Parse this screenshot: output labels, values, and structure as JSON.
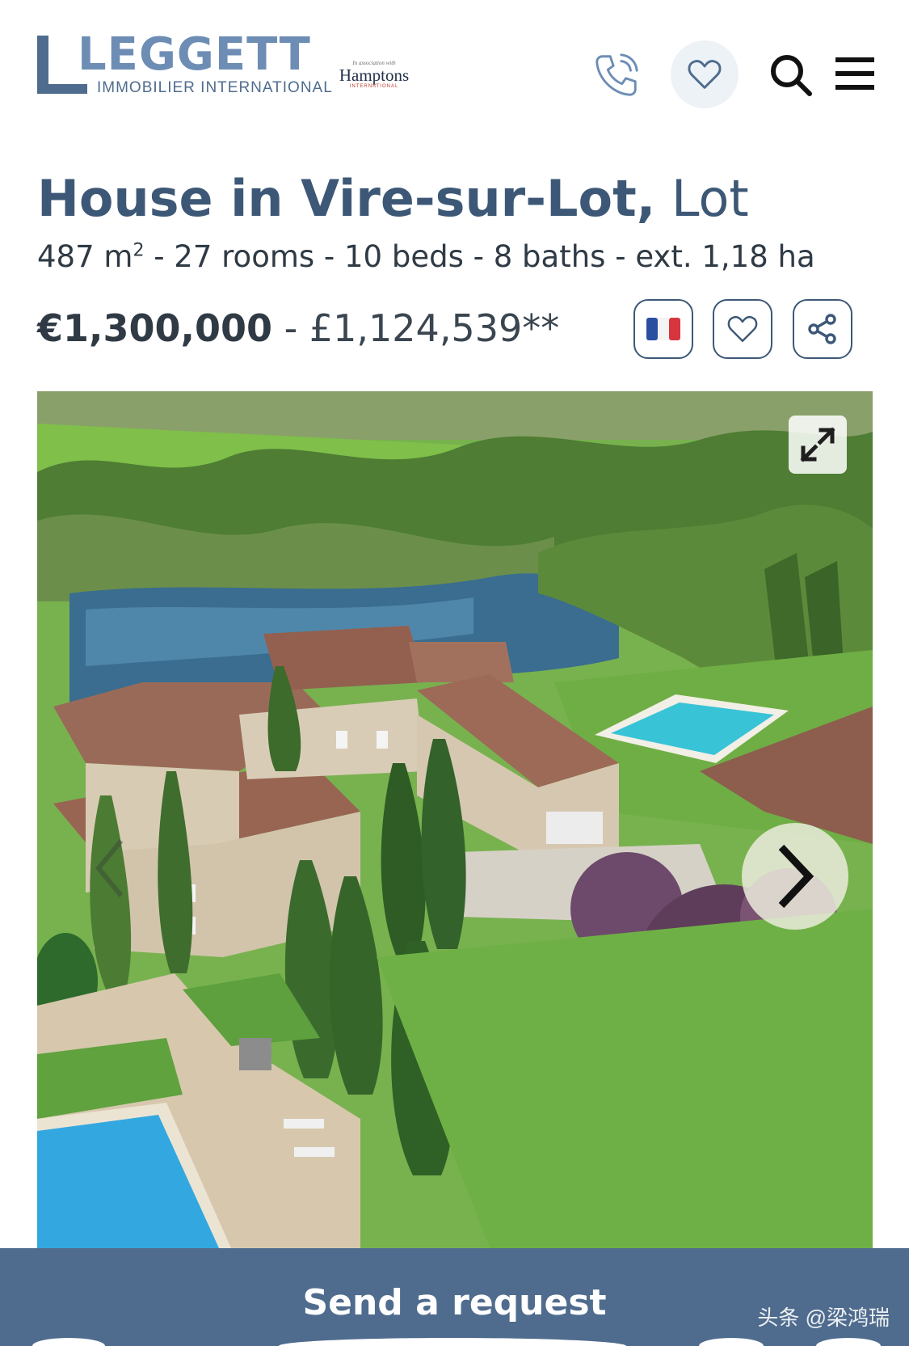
{
  "header": {
    "logo_word": "LEGGETT",
    "logo_sub": "IMMOBILIER INTERNATIONAL",
    "partner": {
      "assoc": "In association with",
      "name": "Hamptons",
      "intl": "INTERNATIONAL"
    },
    "icons": [
      "phone-icon",
      "heart-icon",
      "search-icon",
      "hamburger-menu-icon"
    ]
  },
  "listing": {
    "type_prefix": "House in Vire-sur-Lot",
    "separator": ",",
    "region": " Lot",
    "area": "487 m",
    "area_sup": "2",
    "specs_rest": " - 27 rooms - 10 beds - 8 baths - ext. 1,18 ha",
    "price_eur": "€1,300,000",
    "price_sep": " - ",
    "price_gbp": "£1,124,539**",
    "actions": [
      "french-flag-icon",
      "heart-icon",
      "share-icon"
    ]
  },
  "gallery": {
    "image_alt": "Aerial view of stone house with pools beside river",
    "controls": [
      "expand-icon",
      "chevron-left-icon",
      "chevron-right-icon"
    ]
  },
  "cta": {
    "label": "Send a request",
    "watermark": "头条 @梁鸿瑞"
  },
  "colors": {
    "brand": "#4f6c8e",
    "brand_light": "#8ea8c8",
    "title": "#3d5877",
    "text": "#2f3a44"
  }
}
